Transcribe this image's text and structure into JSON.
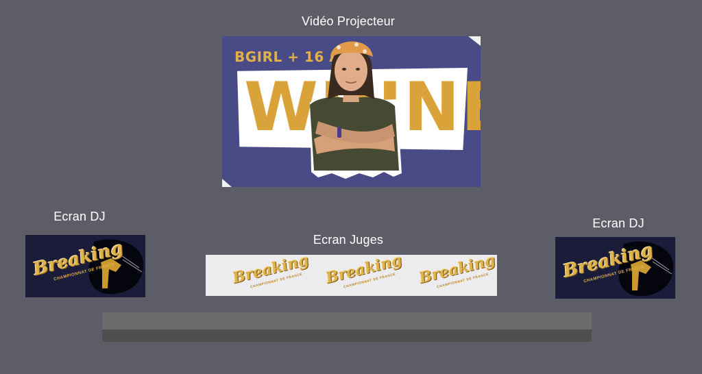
{
  "labels": {
    "projector": "Vidéo Projecteur",
    "dj_left": "Ecran DJ",
    "judges": "Ecran Juges",
    "dj_right": "Ecran DJ"
  },
  "projector_content": {
    "tag": "BGIRL + 16 ANS",
    "headline": "WINNER"
  },
  "logo": {
    "word": "Breaking",
    "sub": "CHAMPIONNAT DE FRANCE"
  },
  "colors": {
    "background": "#5d5d68",
    "projector_bg": "#494b86",
    "gold": "#d9a33a",
    "dj_bg": "#1a1c3a",
    "judges_bg": "#ececef",
    "stage_top": "#6b6b6b",
    "stage_bottom": "#4f4f4f"
  }
}
